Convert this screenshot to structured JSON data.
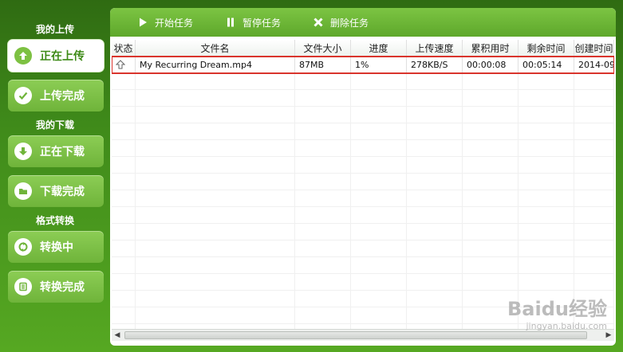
{
  "sidebar": {
    "section_upload": "我的上传",
    "section_download": "我的下载",
    "section_convert": "格式转换",
    "items": [
      {
        "label": "正在上传",
        "icon": "upload-arrow-icon"
      },
      {
        "label": "上传完成",
        "icon": "checkmark-icon"
      },
      {
        "label": "正在下载",
        "icon": "download-arrow-icon"
      },
      {
        "label": "下载完成",
        "icon": "folder-icon"
      },
      {
        "label": "转换中",
        "icon": "convert-icon"
      },
      {
        "label": "转换完成",
        "icon": "list-icon"
      }
    ]
  },
  "toolbar": {
    "start_label": "开始任务",
    "pause_label": "暂停任务",
    "delete_label": "删除任务"
  },
  "table": {
    "headers": [
      "状态",
      "文件名",
      "文件大小",
      "进度",
      "上传速度",
      "累积用时",
      "剩余时间",
      "创建时间"
    ],
    "rows": [
      {
        "status_icon": "upload-status-icon",
        "filename": "My Recurring Dream.mp4",
        "size": "87MB",
        "progress": "1%",
        "speed": "278KB/S",
        "elapsed": "00:00:08",
        "remaining": "00:05:14",
        "created": "2014-09"
      }
    ]
  },
  "watermark": {
    "brand": "Baidu经验",
    "url": "jingyan.baidu.com"
  },
  "colors": {
    "accent_green": "#6fb43a",
    "selected_outline": "#d9342c"
  }
}
